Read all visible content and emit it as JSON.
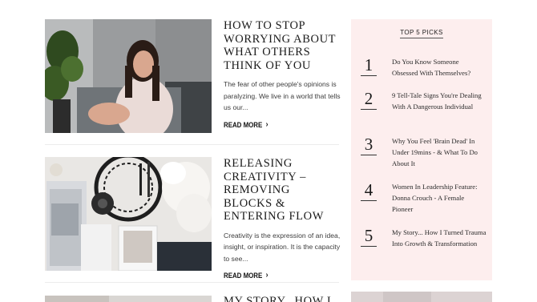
{
  "posts": [
    {
      "title": "HOW TO STOP WORRYING ABOUT WHAT OTHERS THINK OF YOU",
      "excerpt": "The fear of other people's opinions is paralyzing. We live in a world that tells us our...",
      "read_more": "READ MORE"
    },
    {
      "title": "RELEASING CREATIVITY – REMOVING BLOCKS & ENTERING FLOW",
      "excerpt": "Creativity is the expression of an idea, insight, or inspiration. It is the capacity to see...",
      "read_more": "READ MORE"
    },
    {
      "title": "MY STORY.. HOW I"
    }
  ],
  "sidebar": {
    "title": "TOP 5 PICKS",
    "picks": [
      {
        "num": "1",
        "text": "Do You Know Someone Obsessed With Themselves?"
      },
      {
        "num": "2",
        "text": "9 Tell-Tale Signs You're Dealing With A Dangerous Individual"
      },
      {
        "num": "3",
        "text": "Why You Feel 'Brain Dead' In Under 19mins - & What To Do About It"
      },
      {
        "num": "4",
        "text": "Women In Leadership Feature: Donna Crouch - A Female Pioneer"
      },
      {
        "num": "5",
        "text": "My Story... How I Turned Trauma Into Growth & Transformation"
      }
    ]
  },
  "icons": {
    "read_more_arrow": "chevron-right-icon"
  },
  "colors": {
    "sidebar_bg": "#fdeeee",
    "divider": "#ececec"
  }
}
